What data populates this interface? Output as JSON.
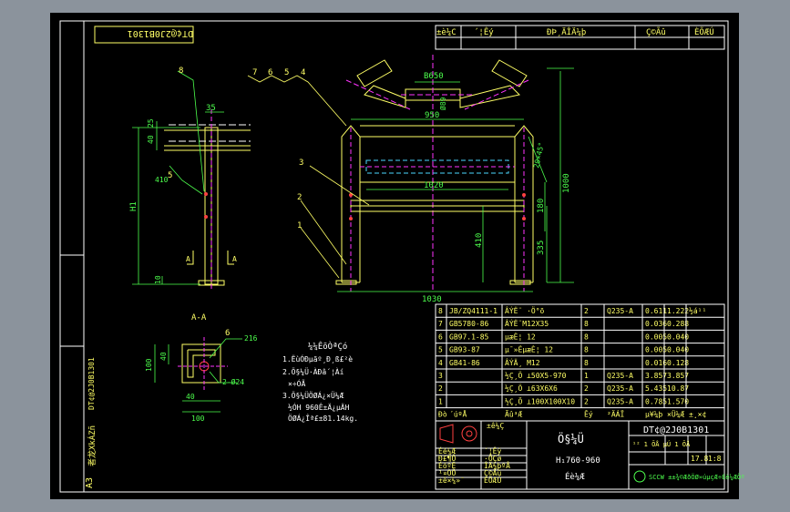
{
  "sheet": {
    "size_mark": "A3",
    "rotated_code_top": "DT¢@2J0B1301",
    "rotated_code_side": "DT¢@2J0B1301",
    "side_text": "者龙XkÁZñ"
  },
  "top_revision_header": [
    "±è¼C",
    "´¦Êý",
    "ÐÞ¸ÄÎÄ¼þ",
    "Ç©Ãû",
    "ÈÕÆÚ"
  ],
  "dimensions": {
    "b650": "B650",
    "d950": "950",
    "d1020": "1020",
    "d1030": "1030",
    "d1000": "1000",
    "d180": "180",
    "d410": "410",
    "d335": "335",
    "angle": "20×45°",
    "d89": "Ø89",
    "h1": "H1",
    "d35": "35",
    "d25": "25",
    "d40": "40",
    "d10": "10",
    "d410b": "410",
    "d100": "100",
    "d40b": "40",
    "d100b": "100",
    "d40c": "40",
    "d216": "216",
    "d2_24": "2-Ø24",
    "section": "A-A",
    "sec_a": "A",
    "sec_a2": "A"
  },
  "leaders": {
    "top": [
      "7",
      "6",
      "5",
      "4"
    ],
    "left": [
      "3",
      "2",
      "1"
    ],
    "side": [
      "8",
      "5",
      "6"
    ]
  },
  "notes": [
    "¼¼ÊõÒªÇó",
    "1.ËùÓÐµãº¸Ð¸ß£²è",
    "2.Ö§¼Ü·ÀÐâ´¦Àí",
    "  ×÷ÓÃ",
    "3.Ö§¼ÜÖØÁ¿×Ü¼Æ",
    "  ½ÓH 960Ê±Ä¿µÄH",
    "  ÖØÁ¿Îª£±81.14kg."
  ],
  "bom": {
    "rows": [
      [
        "8",
        "JB/ZQ4111-1",
        "ÂÝË¨ ·Ö°õ",
        "2",
        "Q235-A",
        "0.611",
        "1.222",
        "½á¹¹"
      ],
      [
        "7",
        "GB5780-86",
        "ÂÝË¨M12X35",
        "8",
        "",
        "0.036",
        "0.288",
        ""
      ],
      [
        "6",
        "GB97.1-85",
        "µæÈ¦ 12",
        "8",
        "",
        "0.005",
        "0.040",
        ""
      ],
      [
        "5",
        "GB93-87",
        "µ¯»ÉµæÈ¦ 12",
        "8",
        "",
        "0.005",
        "0.040",
        ""
      ],
      [
        "4",
        "GB41-86",
        "ÂÝÄ¸ M12",
        "8",
        "",
        "0.016",
        "0.128",
        ""
      ],
      [
        "3",
        "",
        "½Ç¸Ö ⊥50X5-970",
        "1",
        "Q235-A",
        "3.857",
        "3.857",
        ""
      ],
      [
        "2",
        "",
        "½Ç¸Ö ⊥63X6X6",
        "2",
        "Q235-A",
        "5.435",
        "10.87",
        ""
      ],
      [
        "1",
        "",
        "½Ç¸Ö ⊥100X100X10",
        "2",
        "Q235-A",
        "0.785",
        "1.570",
        ""
      ]
    ],
    "header": [
      "Ðò",
      "´úºÅ",
      "Ãû³Æ",
      "Êý",
      "²ÄÁÏ",
      "µ¥¼þ",
      "×Ü¼Æ",
      "±¸×¢"
    ]
  },
  "title_block": {
    "drawing_no": "DT¢@2J0B1301",
    "name": "Ö§¼Ü",
    "spec": "H₁760-960",
    "unit_label": "Éè¼Æ",
    "weight": "17.8",
    "scale": "1:8",
    "labels": [
      "±ê¼Ç",
      "´¦Êý",
      "·ÖÇø",
      "ÎÄ¼þºÅ",
      "Ç©Ãû",
      "ÈÕÆÚ"
    ],
    "rows": [
      "Éè¼Æ",
      "Ð£¶Ô",
      "ÉóºË",
      "¹¤ÒÕ",
      "±ê×¼»¯",
      "Åú×¼"
    ],
    "company": "SCCW ±±¾©ÆðÖØ»úµçÆ÷Éè¼ÆÔº",
    "sheet_of": "¹² 1 ÕÅ µÚ 1 ÕÅ"
  },
  "colors": {
    "frame": "#8b939c",
    "paper": "#000000",
    "border": "#ffffff",
    "yellow": "#ffff66",
    "cyan": "#4dd8ff",
    "magenta": "#ff33ff",
    "green": "#4dff4d",
    "red": "#ff4040"
  }
}
